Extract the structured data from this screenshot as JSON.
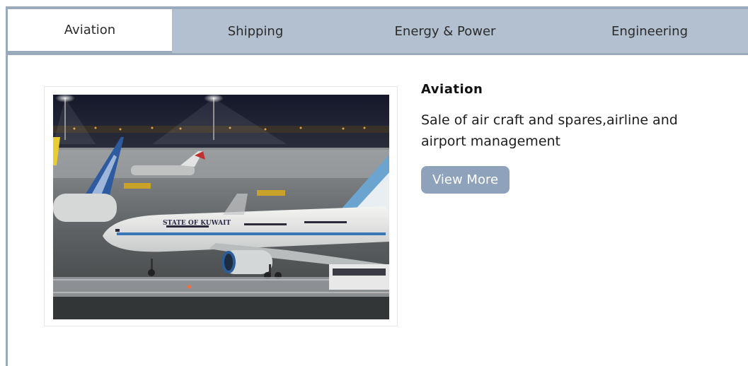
{
  "tabs": [
    {
      "label": "Aviation",
      "active": true
    },
    {
      "label": "Shipping",
      "active": false
    },
    {
      "label": "Energy & Power",
      "active": false
    },
    {
      "label": "Engineering",
      "active": false
    }
  ],
  "panel": {
    "image_text": "STATE OF KUWAIT",
    "title": "Aviation",
    "description": "Sale of air craft and spares,airline and airport management",
    "button_label": "View More"
  },
  "colors": {
    "tab_bar": "#b2c0cf",
    "border": "#9aa9bb",
    "button": "#8ea3bb"
  }
}
